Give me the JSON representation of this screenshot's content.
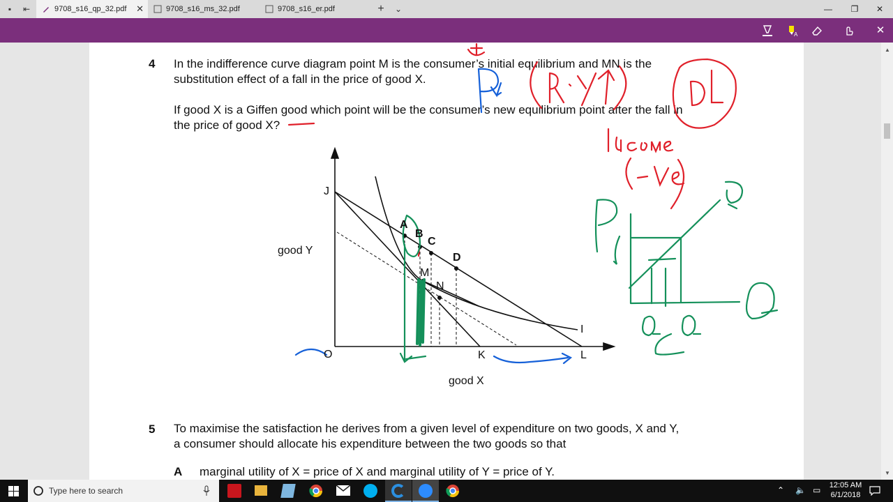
{
  "browser": {
    "tabs": [
      {
        "title": "9708_s16_qp_32.pdf",
        "active": true
      },
      {
        "title": "9708_s16_ms_32.pdf",
        "active": false
      },
      {
        "title": "9708_s16_er.pdf",
        "active": false
      }
    ],
    "new_tab_glyph": "+",
    "tab_menu_glyph": "⌄"
  },
  "window_controls": {
    "minimize": "—",
    "restore": "❐",
    "close": "✕"
  },
  "ink_toolbar": {
    "tools": [
      "ballpoint-pen-icon",
      "highlighter-icon",
      "eraser-icon",
      "touch-writing-icon"
    ],
    "close": "✕",
    "color": "#7b2f7c"
  },
  "document": {
    "q4": {
      "number": "4",
      "line1": "In the indifference curve diagram point M is the consumer’s initial equilibrium and MN is the",
      "line2": "substitution effect of a fall in the price of good X.",
      "line3": "If good X is a Giffen good which point will be the consumer’s new equilibrium point after the fall in",
      "line4": "the price of good X?",
      "diagram": {
        "points": [
          "J",
          "A",
          "B",
          "C",
          "D",
          "M",
          "N",
          "I",
          "O",
          "K",
          "L"
        ],
        "y_label": "good Y",
        "x_label": "good X"
      }
    },
    "q5": {
      "number": "5",
      "line1": "To maximise the satisfaction he derives from a given level of expenditure on two goods, X and Y,",
      "line2": "a consumer should allocate his expenditure between the two goods so that",
      "optA_letter": "A",
      "optA_text": "marginal utility of X = price of X and marginal utility of Y = price of Y."
    }
  },
  "annotations": {
    "red_plus": "+",
    "blue_px": "Px",
    "red_ry": "(R·Y↑)",
    "red_d": "(D↓)",
    "red_income": "income",
    "red_ve": "(-ve)",
    "green_p": "P",
    "green_d": "D",
    "green_q_right": "Q",
    "green_q_left": "Q",
    "green_q_mid": "Q",
    "ink_colors": {
      "red": "#e0202a",
      "blue": "#1560d8",
      "green": "#14905a"
    }
  },
  "taskbar": {
    "search_placeholder": "Type here to search",
    "apps": [
      "acrobat-icon",
      "file-explorer-icon",
      "notepad-icon",
      "chrome-icon",
      "mail-icon",
      "skype-icon",
      "edge-icon",
      "zoom-icon",
      "chrome-icon-2"
    ],
    "time": "12:05 AM",
    "date": "6/1/2018"
  }
}
